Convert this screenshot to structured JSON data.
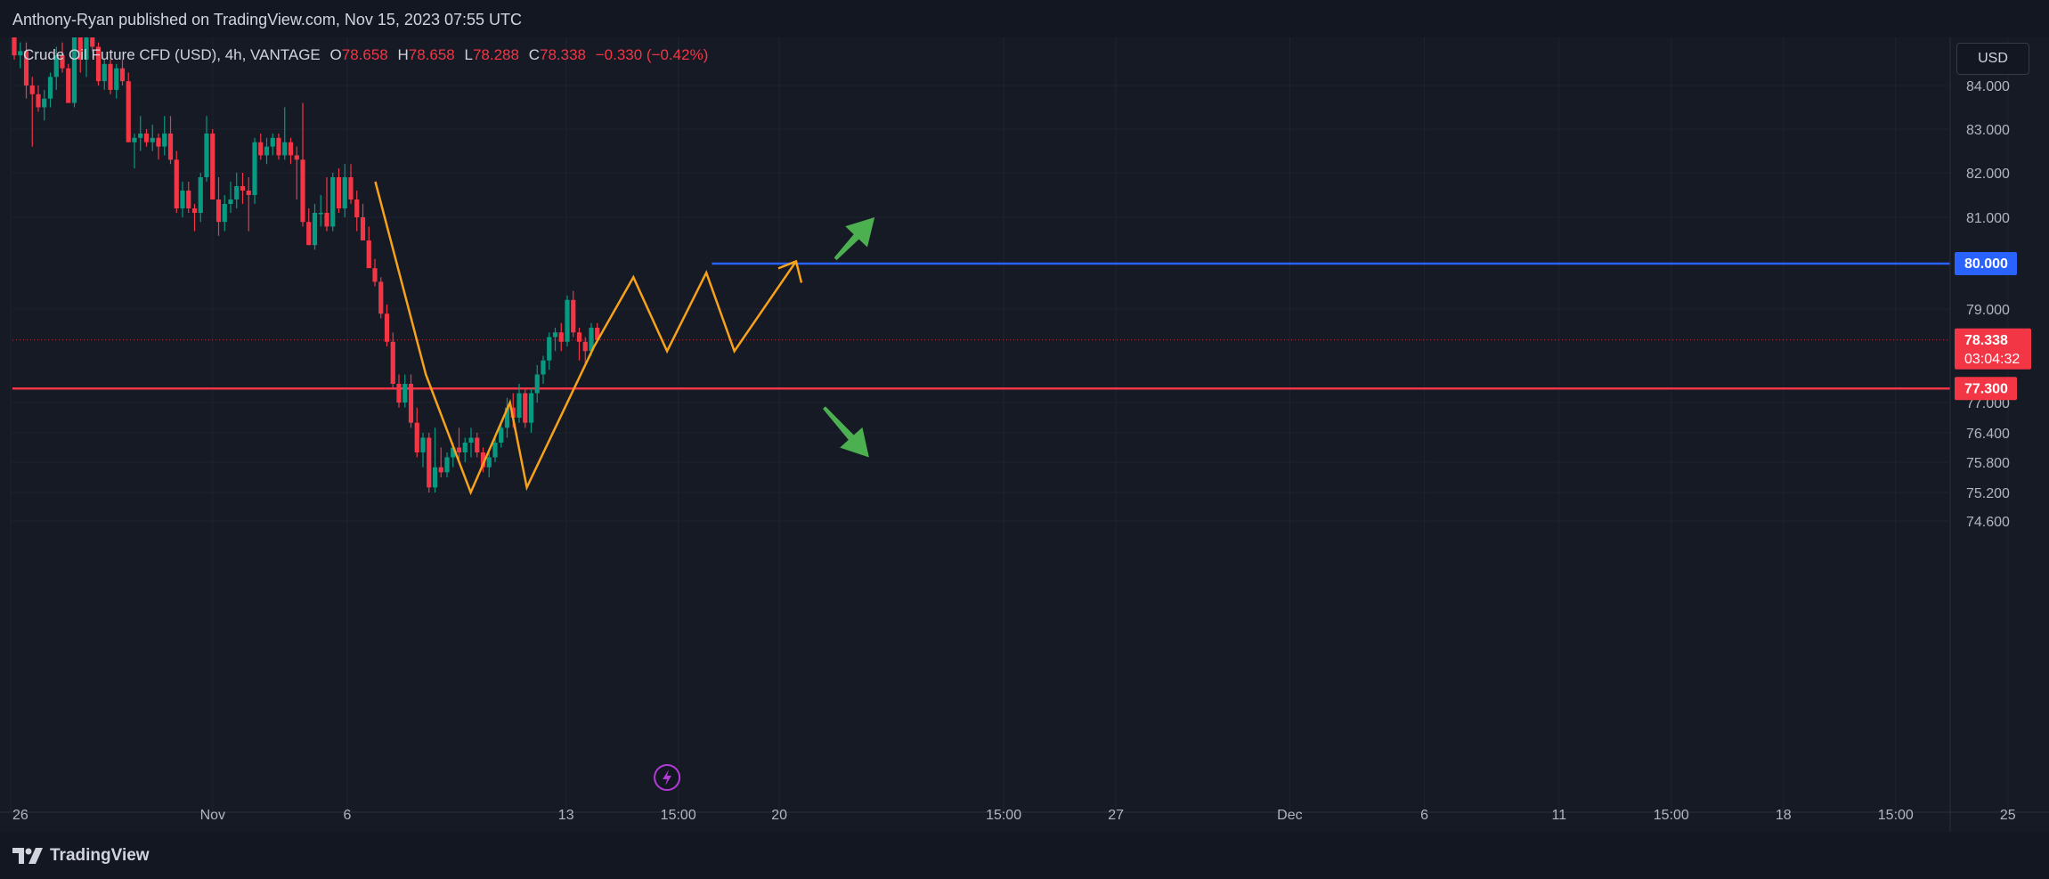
{
  "header": {
    "publisher_text": "Anthony-Ryan published on TradingView.com, Nov 15, 2023 07:55 UTC"
  },
  "legend": {
    "symbol": "Crude Oil Future CFD (USD), 4h, VANTAGE",
    "o_label": "O",
    "o_value": "78.658",
    "h_label": "H",
    "h_value": "78.658",
    "l_label": "L",
    "l_value": "78.288",
    "c_label": "C",
    "c_value": "78.338",
    "change": "−0.330 (−0.42%)"
  },
  "currency_button": "USD",
  "footer": {
    "brand": "TradingView"
  },
  "colors": {
    "background": "#161a25",
    "up": "#089981",
    "down": "#f23645",
    "pattern": "#f7a21b",
    "resistance": "#2962ff",
    "support": "#f23645",
    "arrow": "#4caf50"
  },
  "chart_data": {
    "type": "candlestick",
    "timeframe": "4h",
    "y_ticks": [
      "84.000",
      "83.000",
      "82.000",
      "81.000",
      "79.000",
      "77.000",
      "76.400",
      "75.800",
      "75.200",
      "74.600"
    ],
    "y_tick_values": [
      84.0,
      83.0,
      82.0,
      81.0,
      79.0,
      77.0,
      76.4,
      75.8,
      75.2,
      74.6
    ],
    "x_ticks": [
      "26",
      "Nov",
      "6",
      "13",
      "15:00",
      "20",
      "15:00",
      "27",
      "Dec",
      "6",
      "11",
      "15:00",
      "18",
      "15:00",
      "25"
    ],
    "x_tick_indices": [
      0,
      36,
      60,
      99,
      119,
      137,
      177,
      197,
      228,
      252,
      276,
      296,
      316,
      336,
      356
    ],
    "price_labels": [
      {
        "value": 80.0,
        "text": "80.000",
        "color": "#2962ff"
      },
      {
        "value": 78.338,
        "text": "78.338",
        "subtext": "03:04:32",
        "color": "#f23645"
      },
      {
        "value": 77.3,
        "text": "77.300",
        "color": "#f23645"
      }
    ],
    "horizontal_lines": [
      {
        "name": "resistance",
        "value": 80.0,
        "from_index": 125
      },
      {
        "name": "support",
        "value": 77.3,
        "from_index": 0
      },
      {
        "name": "last-price",
        "value": 78.338,
        "from_index": 0,
        "dotted": true
      }
    ],
    "candles": [
      [
        85.2,
        85.4,
        84.6,
        84.7
      ],
      [
        84.7,
        85.0,
        84.4,
        84.8
      ],
      [
        84.8,
        85.0,
        83.7,
        84.0
      ],
      [
        84.0,
        84.2,
        82.6,
        83.8
      ],
      [
        83.8,
        84.0,
        83.4,
        83.5
      ],
      [
        83.5,
        83.9,
        83.2,
        83.7
      ],
      [
        83.7,
        84.3,
        83.5,
        84.2
      ],
      [
        84.2,
        84.9,
        83.9,
        84.7
      ],
      [
        84.7,
        85.0,
        84.3,
        84.4
      ],
      [
        84.4,
        84.5,
        83.6,
        83.6
      ],
      [
        83.6,
        85.6,
        83.5,
        85.4
      ],
      [
        85.4,
        85.5,
        84.3,
        84.6
      ],
      [
        84.6,
        85.3,
        84.2,
        85.2
      ],
      [
        85.2,
        85.4,
        84.8,
        84.9
      ],
      [
        84.9,
        85.0,
        84.0,
        84.1
      ],
      [
        84.1,
        84.6,
        83.9,
        84.5
      ],
      [
        84.5,
        84.6,
        83.8,
        83.9
      ],
      [
        83.9,
        84.5,
        83.7,
        84.4
      ],
      [
        84.4,
        84.6,
        84.0,
        84.1
      ],
      [
        84.1,
        84.3,
        82.7,
        82.7
      ],
      [
        82.7,
        82.9,
        82.1,
        82.8
      ],
      [
        82.8,
        83.3,
        82.5,
        82.9
      ],
      [
        82.9,
        83.0,
        82.6,
        82.7
      ],
      [
        82.7,
        83.1,
        82.5,
        82.8
      ],
      [
        82.8,
        82.9,
        82.3,
        82.6
      ],
      [
        82.6,
        83.3,
        82.4,
        82.9
      ],
      [
        82.9,
        83.3,
        82.2,
        82.3
      ],
      [
        82.3,
        82.5,
        81.1,
        81.2
      ],
      [
        81.2,
        81.8,
        81.0,
        81.6
      ],
      [
        81.6,
        81.8,
        81.1,
        81.2
      ],
      [
        81.2,
        81.3,
        80.7,
        81.1
      ],
      [
        81.1,
        82.0,
        80.9,
        81.9
      ],
      [
        81.9,
        83.3,
        81.8,
        82.9
      ],
      [
        82.9,
        83.0,
        81.4,
        81.4
      ],
      [
        81.4,
        81.9,
        80.6,
        80.9
      ],
      [
        80.9,
        81.5,
        80.7,
        81.3
      ],
      [
        81.3,
        81.8,
        81.1,
        81.4
      ],
      [
        81.4,
        82.0,
        81.2,
        81.7
      ],
      [
        81.7,
        82.0,
        81.3,
        81.6
      ],
      [
        81.6,
        81.9,
        80.7,
        81.5
      ],
      [
        81.5,
        82.8,
        81.3,
        82.7
      ],
      [
        82.7,
        82.9,
        82.3,
        82.4
      ],
      [
        82.4,
        82.8,
        82.2,
        82.6
      ],
      [
        82.6,
        82.9,
        82.4,
        82.8
      ],
      [
        82.8,
        82.9,
        82.3,
        82.4
      ],
      [
        82.4,
        83.5,
        82.3,
        82.7
      ],
      [
        82.7,
        82.8,
        82.2,
        82.4
      ],
      [
        82.4,
        82.6,
        81.4,
        82.3
      ],
      [
        82.3,
        83.6,
        80.8,
        80.9
      ],
      [
        80.9,
        81.2,
        80.4,
        80.4
      ],
      [
        80.4,
        81.3,
        80.3,
        81.1
      ],
      [
        81.1,
        81.5,
        80.8,
        81.1
      ],
      [
        81.1,
        81.9,
        80.7,
        80.8
      ],
      [
        80.8,
        82.0,
        80.7,
        81.9
      ],
      [
        81.9,
        82.1,
        81.1,
        81.2
      ],
      [
        81.2,
        82.2,
        81.0,
        81.9
      ],
      [
        81.9,
        82.2,
        81.3,
        81.4
      ],
      [
        81.4,
        81.6,
        80.7,
        81.0
      ],
      [
        81.0,
        81.3,
        80.5,
        80.5
      ],
      [
        80.5,
        80.8,
        79.9,
        79.9
      ],
      [
        79.9,
        80.1,
        79.5,
        79.6
      ],
      [
        79.6,
        79.7,
        78.8,
        78.9
      ],
      [
        78.9,
        79.1,
        78.2,
        78.3
      ],
      [
        78.3,
        78.5,
        77.3,
        77.4
      ],
      [
        77.4,
        77.6,
        76.9,
        77.0
      ],
      [
        77.0,
        77.6,
        76.9,
        77.4
      ],
      [
        77.4,
        77.6,
        76.5,
        76.6
      ],
      [
        76.6,
        76.9,
        75.9,
        76.0
      ],
      [
        76.0,
        76.4,
        75.7,
        76.3
      ],
      [
        76.3,
        76.4,
        75.2,
        75.3
      ],
      [
        75.3,
        76.5,
        75.2,
        75.7
      ],
      [
        75.7,
        76.1,
        75.5,
        75.6
      ],
      [
        75.6,
        76.0,
        75.5,
        75.9
      ],
      [
        75.9,
        76.2,
        75.7,
        76.1
      ],
      [
        76.1,
        76.5,
        75.8,
        76.0
      ],
      [
        76.0,
        76.3,
        75.8,
        76.2
      ],
      [
        76.2,
        76.5,
        75.9,
        76.3
      ],
      [
        76.3,
        76.4,
        75.9,
        76.0
      ],
      [
        76.0,
        76.1,
        75.6,
        75.7
      ],
      [
        75.7,
        76.0,
        75.5,
        75.9
      ],
      [
        75.9,
        76.3,
        75.8,
        76.2
      ],
      [
        76.2,
        76.6,
        76.1,
        76.5
      ],
      [
        76.5,
        77.1,
        76.3,
        76.9
      ],
      [
        76.9,
        77.2,
        76.5,
        76.7
      ],
      [
        76.7,
        77.4,
        76.6,
        77.2
      ],
      [
        77.2,
        77.3,
        76.5,
        76.6
      ],
      [
        76.6,
        77.3,
        76.4,
        77.2
      ],
      [
        77.2,
        77.8,
        77.0,
        77.6
      ],
      [
        77.6,
        78.0,
        77.4,
        77.9
      ],
      [
        77.9,
        78.5,
        77.7,
        78.4
      ],
      [
        78.4,
        78.6,
        78.1,
        78.5
      ],
      [
        78.5,
        78.7,
        78.1,
        78.3
      ],
      [
        78.3,
        79.3,
        78.2,
        79.2
      ],
      [
        79.2,
        79.4,
        78.4,
        78.5
      ],
      [
        78.5,
        78.6,
        77.9,
        78.3
      ],
      [
        78.3,
        78.4,
        77.8,
        78.1
      ],
      [
        78.1,
        78.7,
        78.0,
        78.6
      ],
      [
        78.6,
        78.7,
        78.3,
        78.338
      ]
    ],
    "candle_index_offset": 18,
    "zigzag_pattern": [
      {
        "i": 65,
        "v": 81.8
      },
      {
        "i": 74,
        "v": 77.6
      },
      {
        "i": 82,
        "v": 75.2
      },
      {
        "i": 89,
        "v": 77.0
      },
      {
        "i": 92,
        "v": 75.3
      },
      {
        "i": 104,
        "v": 78.2
      },
      {
        "i": 111,
        "v": 79.7
      },
      {
        "i": 117,
        "v": 78.1
      },
      {
        "i": 124,
        "v": 79.8
      },
      {
        "i": 129,
        "v": 78.1
      },
      {
        "i": 140,
        "v": 80.05
      }
    ],
    "arrows": [
      {
        "name": "up-arrow",
        "from": {
          "i": 147,
          "v": 80.1
        },
        "to": {
          "i": 154,
          "v": 81.0
        }
      },
      {
        "name": "down-arrow",
        "from": {
          "i": 145,
          "v": 76.9
        },
        "to": {
          "i": 153,
          "v": 75.9
        }
      }
    ],
    "event_marker_index": 117,
    "ylim": [
      74.2,
      85.2
    ]
  }
}
